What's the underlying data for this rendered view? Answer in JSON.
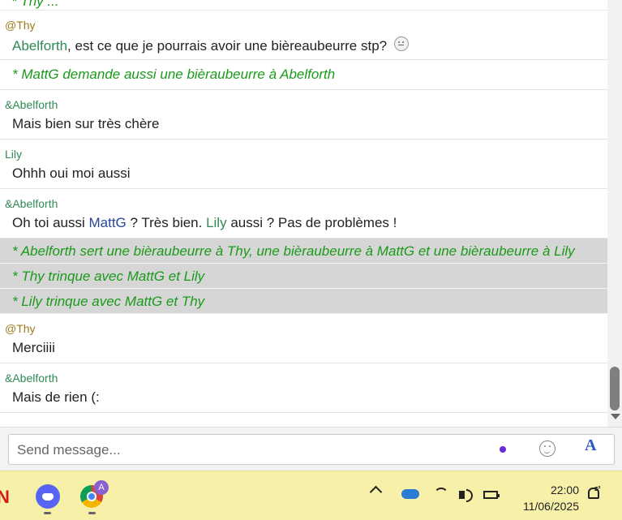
{
  "chat": {
    "top_cut": "* Thy ...",
    "messages": [
      {
        "type": "msg",
        "nick": "@Thy",
        "nick_class": "n-thy",
        "parts": [
          {
            "t": "Abelforth",
            "c": "n-abel"
          },
          {
            "t": ", est ce que je pourrais avoir une bièreaubeurre stp? "
          }
        ],
        "smiley": true
      },
      {
        "type": "action",
        "text": "* MattG demande aussi une bièraubeurre à Abelforth"
      },
      {
        "type": "msg",
        "nick": "&Abelforth",
        "nick_class": "n-abel",
        "parts": [
          {
            "t": "Mais bien sur très chère"
          }
        ]
      },
      {
        "type": "msg",
        "nick": "Lily",
        "nick_class": "n-lily",
        "parts": [
          {
            "t": "Ohhh oui moi aussi"
          }
        ]
      },
      {
        "type": "msg",
        "nick": "&Abelforth",
        "nick_class": "n-abel",
        "parts": [
          {
            "t": "Oh toi aussi "
          },
          {
            "t": "MattG",
            "c": "n-mattg"
          },
          {
            "t": " ? Très bien. "
          },
          {
            "t": "Lily",
            "c": "n-lily"
          },
          {
            "t": " aussi ? Pas de problèmes !"
          }
        ]
      },
      {
        "type": "action",
        "grey": true,
        "text": "* Abelforth sert une bièraubeurre à Thy, une bièraubeurre à MattG et une bièraubeurre à Lily"
      },
      {
        "type": "action",
        "grey": true,
        "text": "* Thy trinque avec MattG et Lily"
      },
      {
        "type": "action",
        "grey": true,
        "text": "* Lily trinque avec MattG et Thy"
      },
      {
        "type": "msg",
        "nick": "@Thy",
        "nick_class": "n-thy",
        "parts": [
          {
            "t": "Merciiii"
          }
        ]
      },
      {
        "type": "msg",
        "nick": "&Abelforth",
        "nick_class": "n-abel",
        "parts": [
          {
            "t": "Mais de rien (:"
          }
        ]
      }
    ]
  },
  "composer": {
    "placeholder": "Send message...",
    "format_label": "A",
    "status_color": "#6a2bd8"
  },
  "taskbar": {
    "apps": [
      "netflix-icon",
      "discord-icon",
      "chrome-icon"
    ],
    "netflix_label": "N",
    "chrome_badge": "A",
    "time": "22:00",
    "date": "11/06/2025",
    "notification_badge": "z²"
  },
  "colors": {
    "action_text": "#1a9a1a",
    "highlight_bg": "#d6d6d6",
    "taskbar_bg": "#f7f0a8",
    "nick_op": "#9c7b1c",
    "nick_green": "#2f8a55",
    "nick_blue": "#24489a"
  }
}
